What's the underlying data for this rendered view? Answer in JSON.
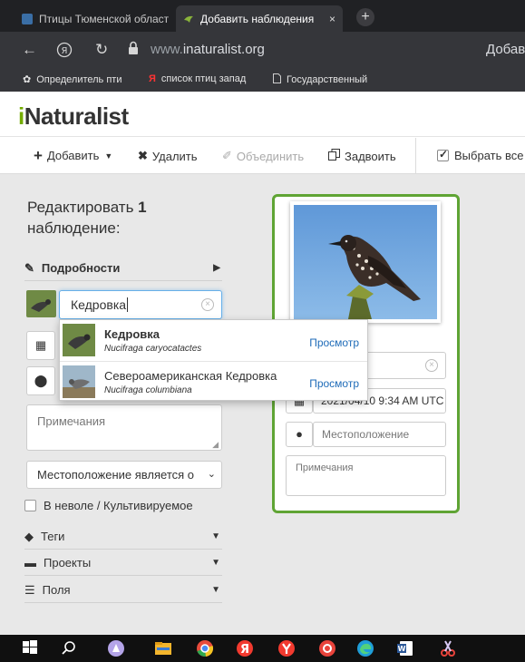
{
  "browser": {
    "tabs": [
      {
        "title": "Птицы Тюменской област",
        "active": false
      },
      {
        "title": "Добавить наблюдения",
        "active": true
      }
    ],
    "close_glyph": "×",
    "newtab_glyph": "+",
    "url_scheme": "www.",
    "url_host": "inaturalist.org",
    "page_heading": "Добав",
    "bookmarks": [
      {
        "label": "Определитель пти",
        "icon": "flower-icon"
      },
      {
        "label": "список птиц запад",
        "icon": "yandex-icon"
      },
      {
        "label": "Государственный",
        "icon": "page-icon"
      }
    ]
  },
  "site": {
    "logo_i": "i",
    "logo_rest": "Naturalist"
  },
  "toolbar": {
    "add_label": "Добавить",
    "add_icon": "plus-icon",
    "delete_label": "Удалить",
    "delete_icon": "x-icon",
    "merge_label": "Объединить",
    "merge_icon": "magic-wand-icon",
    "duplicate_label": "Задвоить",
    "duplicate_icon": "copy-icon",
    "select_all_label": "Выбрать все"
  },
  "sidebar": {
    "edit_prefix": "Редактировать",
    "edit_count": "1",
    "edit_suffix": "наблюдение:",
    "details_label": "Подробности",
    "taxon_value": "Кедровка",
    "notes_placeholder": "Примечания",
    "location_select": "Местоположение является о",
    "captive_label": "В неволе / Культивируемое",
    "tags_label": "Теги",
    "projects_label": "Проекты",
    "fields_label": "Поля"
  },
  "autocomplete": [
    {
      "name": "Кедровка",
      "scientific": "Nucifraga caryocatactes",
      "action": "Просмотр"
    },
    {
      "name": "Североамериканская Кедровка",
      "scientific": "Nucifraga columbiana",
      "action": "Просмотр"
    }
  ],
  "card": {
    "datetime": "2021/04/10 9:34 AM UTC",
    "location_placeholder": "Местоположение",
    "notes_placeholder": "Примечания"
  },
  "colors": {
    "brand_green": "#74ac00",
    "card_border": "#5fa434",
    "link_blue": "#1e6bb8"
  }
}
